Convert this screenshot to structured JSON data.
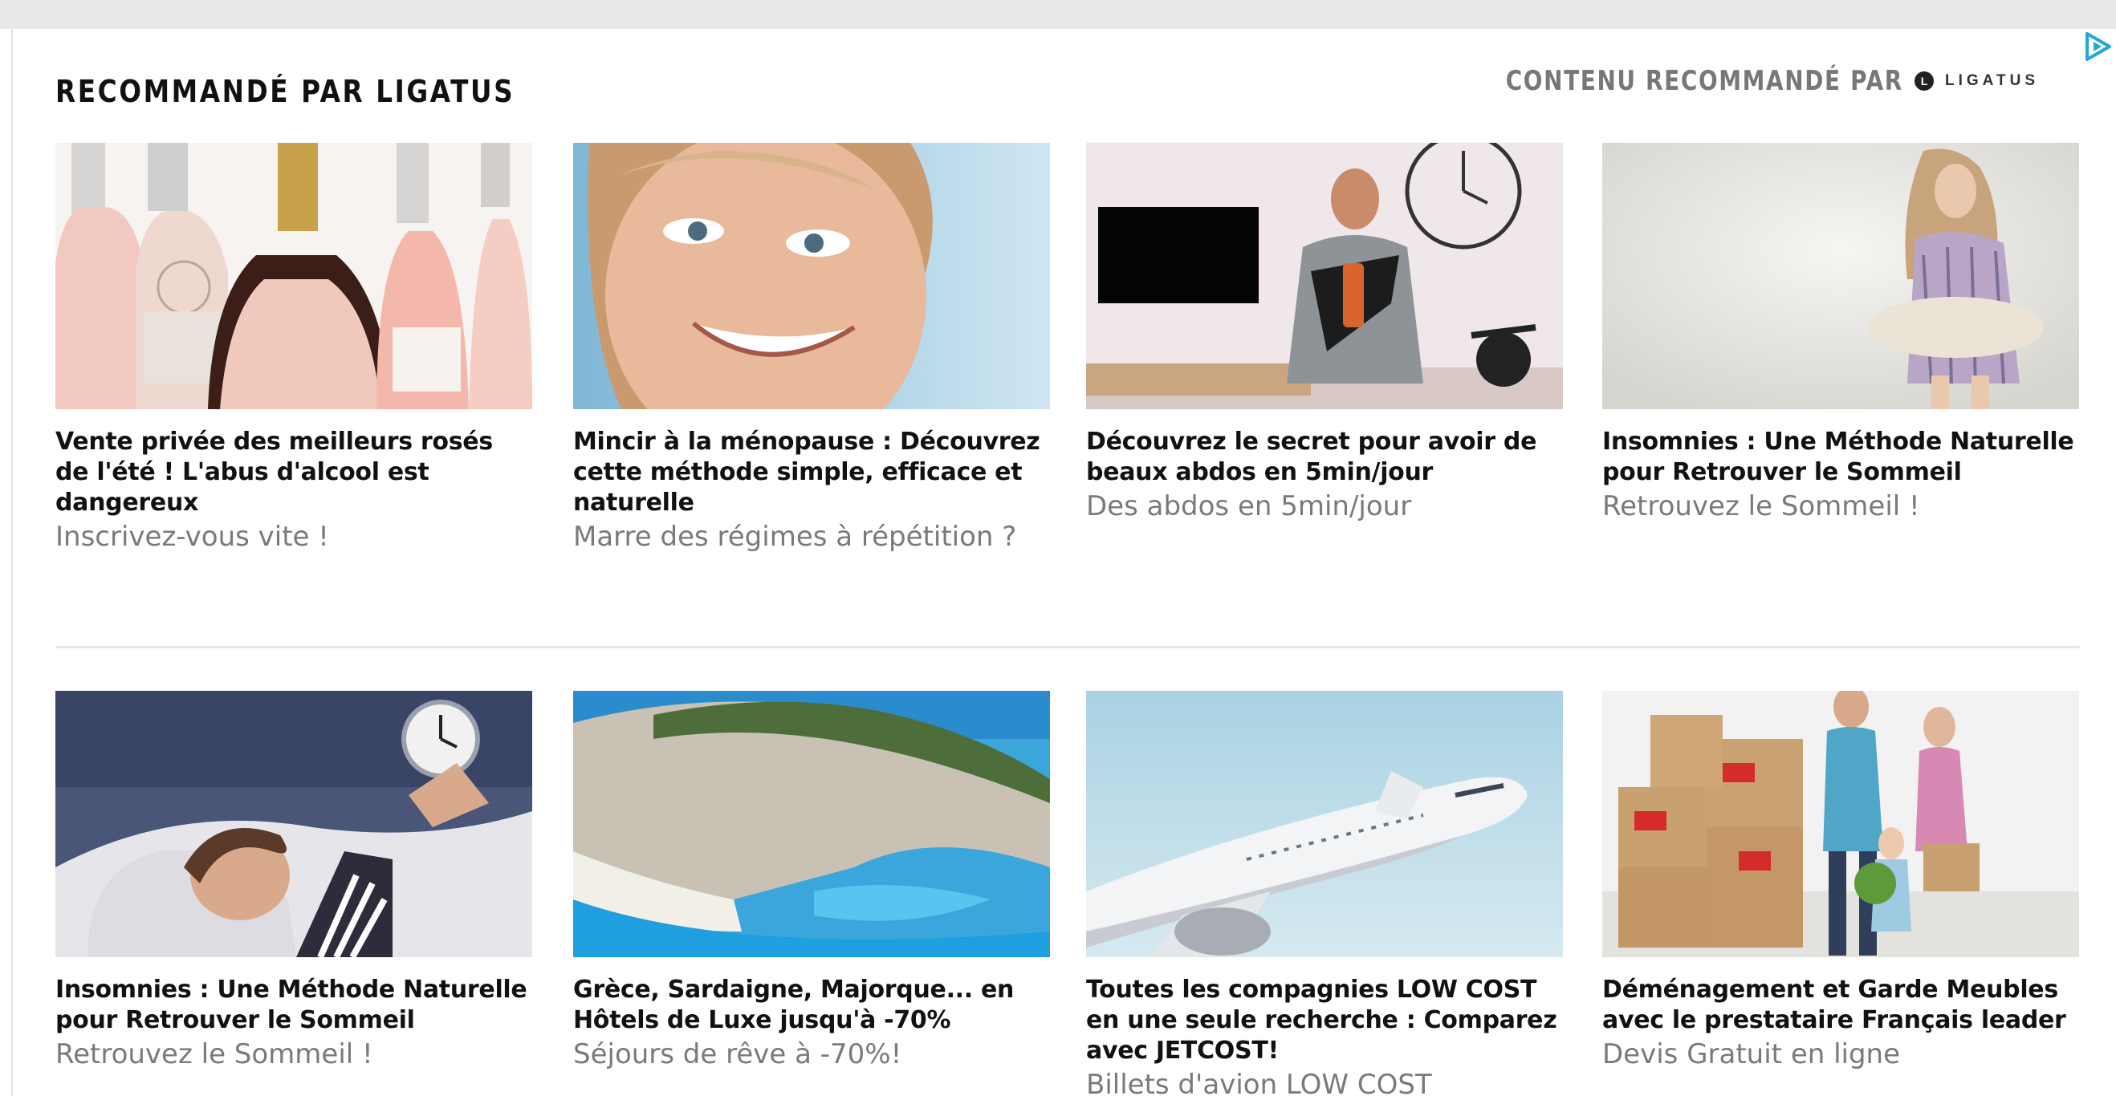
{
  "header": {
    "title": "RECOMMANDÉ PAR LIGATUS",
    "recommended_by": "CONTENU RECOMMANDÉ PAR",
    "logo_letter": "L",
    "logo_word": "LIGATUS"
  },
  "cards": [
    {
      "title": "Vente privée des meilleurs rosés de l'été ! L'abus d'alcool est dangereux",
      "subtitle": "Inscrivez-vous vite !",
      "image": "rose-wine-bottles"
    },
    {
      "title": "Mincir à la ménopause : Découvrez cette méthode simple, efficace et naturelle",
      "subtitle": "Marre des régimes à répétition ?",
      "image": "smiling-woman-portrait"
    },
    {
      "title": "Découvrez le secret pour avoir de beaux abdos en 5min/jour",
      "subtitle": "Des abdos en 5min/jour",
      "image": "man-with-ab-machine"
    },
    {
      "title": "Insomnies : Une Méthode Naturelle pour Retrouver le Sommeil",
      "subtitle": "Retrouvez le Sommeil !",
      "image": "tired-woman-with-pillow"
    },
    {
      "title": "Insomnies : Une Méthode Naturelle pour Retrouver le Sommeil",
      "subtitle": "Retrouvez le Sommeil !",
      "image": "woman-in-bed-alarm-clock"
    },
    {
      "title": "Grèce, Sardaigne, Majorque... en Hôtels de Luxe jusqu'à -70%",
      "subtitle": "Séjours de rêve à -70%!",
      "image": "navagio-beach-cliffs"
    },
    {
      "title": "Toutes les compagnies LOW COST en une seule recherche : Comparez avec JETCOST!",
      "subtitle": "Billets d'avion LOW COST",
      "image": "airplane-in-sky"
    },
    {
      "title": "Déménagement et Garde Meubles avec le prestataire Français leader",
      "subtitle": "Devis Gratuit en ligne",
      "image": "family-moving-boxes"
    }
  ],
  "colors": {
    "title_text": "#111111",
    "subtitle_text": "#7a7a7a",
    "header_right_text": "#777777",
    "adchoice": "#25a6d9"
  }
}
